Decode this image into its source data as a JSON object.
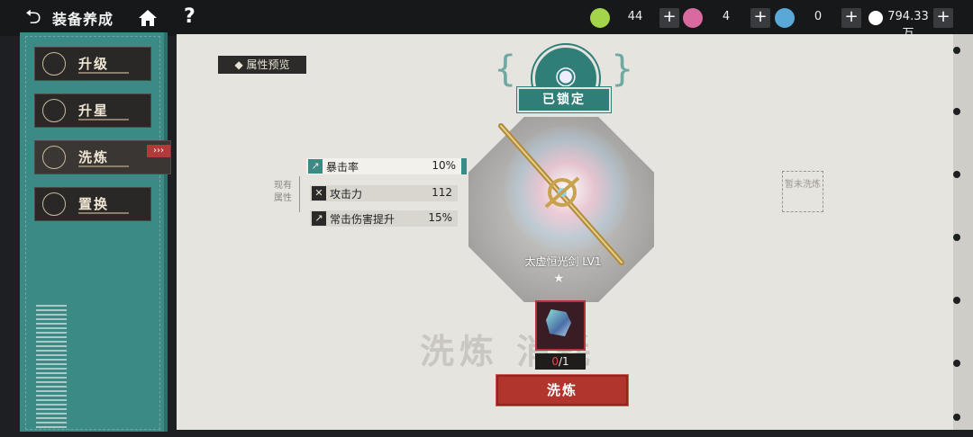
{
  "header": {
    "title": "装备养成",
    "back_icon": "back-arrow-icon",
    "home_icon": "home-icon",
    "help_label": "?"
  },
  "resources": [
    {
      "name": "green-gem",
      "value": "44",
      "color": "#a3d44a"
    },
    {
      "name": "pink-gem",
      "value": "4",
      "color": "#d86aa0"
    },
    {
      "name": "blue-gem",
      "value": "0",
      "color": "#5aa8d8"
    },
    {
      "name": "coin",
      "value": "794.33万",
      "color": "#ffffff"
    }
  ],
  "plus_label": "+",
  "sidebar": {
    "items": [
      {
        "label": "升级",
        "icon": "swords-icon"
      },
      {
        "label": "升星",
        "icon": "star-icon"
      },
      {
        "label": "洗炼",
        "icon": "refine-icon",
        "active": true
      },
      {
        "label": "置换",
        "icon": "swap-icon"
      }
    ],
    "active_arrows": "›››"
  },
  "main": {
    "preview_label": "属性预览",
    "locked_label": "已锁定",
    "current_attr_label": "现有属性",
    "pending_label": "暂未洗炼",
    "weapon_name": "太虚恒光剑 LV1",
    "attributes": [
      {
        "name": "暴击率",
        "value": "10%"
      },
      {
        "name": "攻击力",
        "value": "112"
      },
      {
        "name": "常击伤害提升",
        "value": "15%"
      }
    ],
    "consume_watermark": "洗炼 消耗",
    "consume_have": "0",
    "consume_need": "/1",
    "refine_button": "洗炼"
  },
  "colors": {
    "accent": "#3b8a86",
    "button": "#b1342d"
  }
}
